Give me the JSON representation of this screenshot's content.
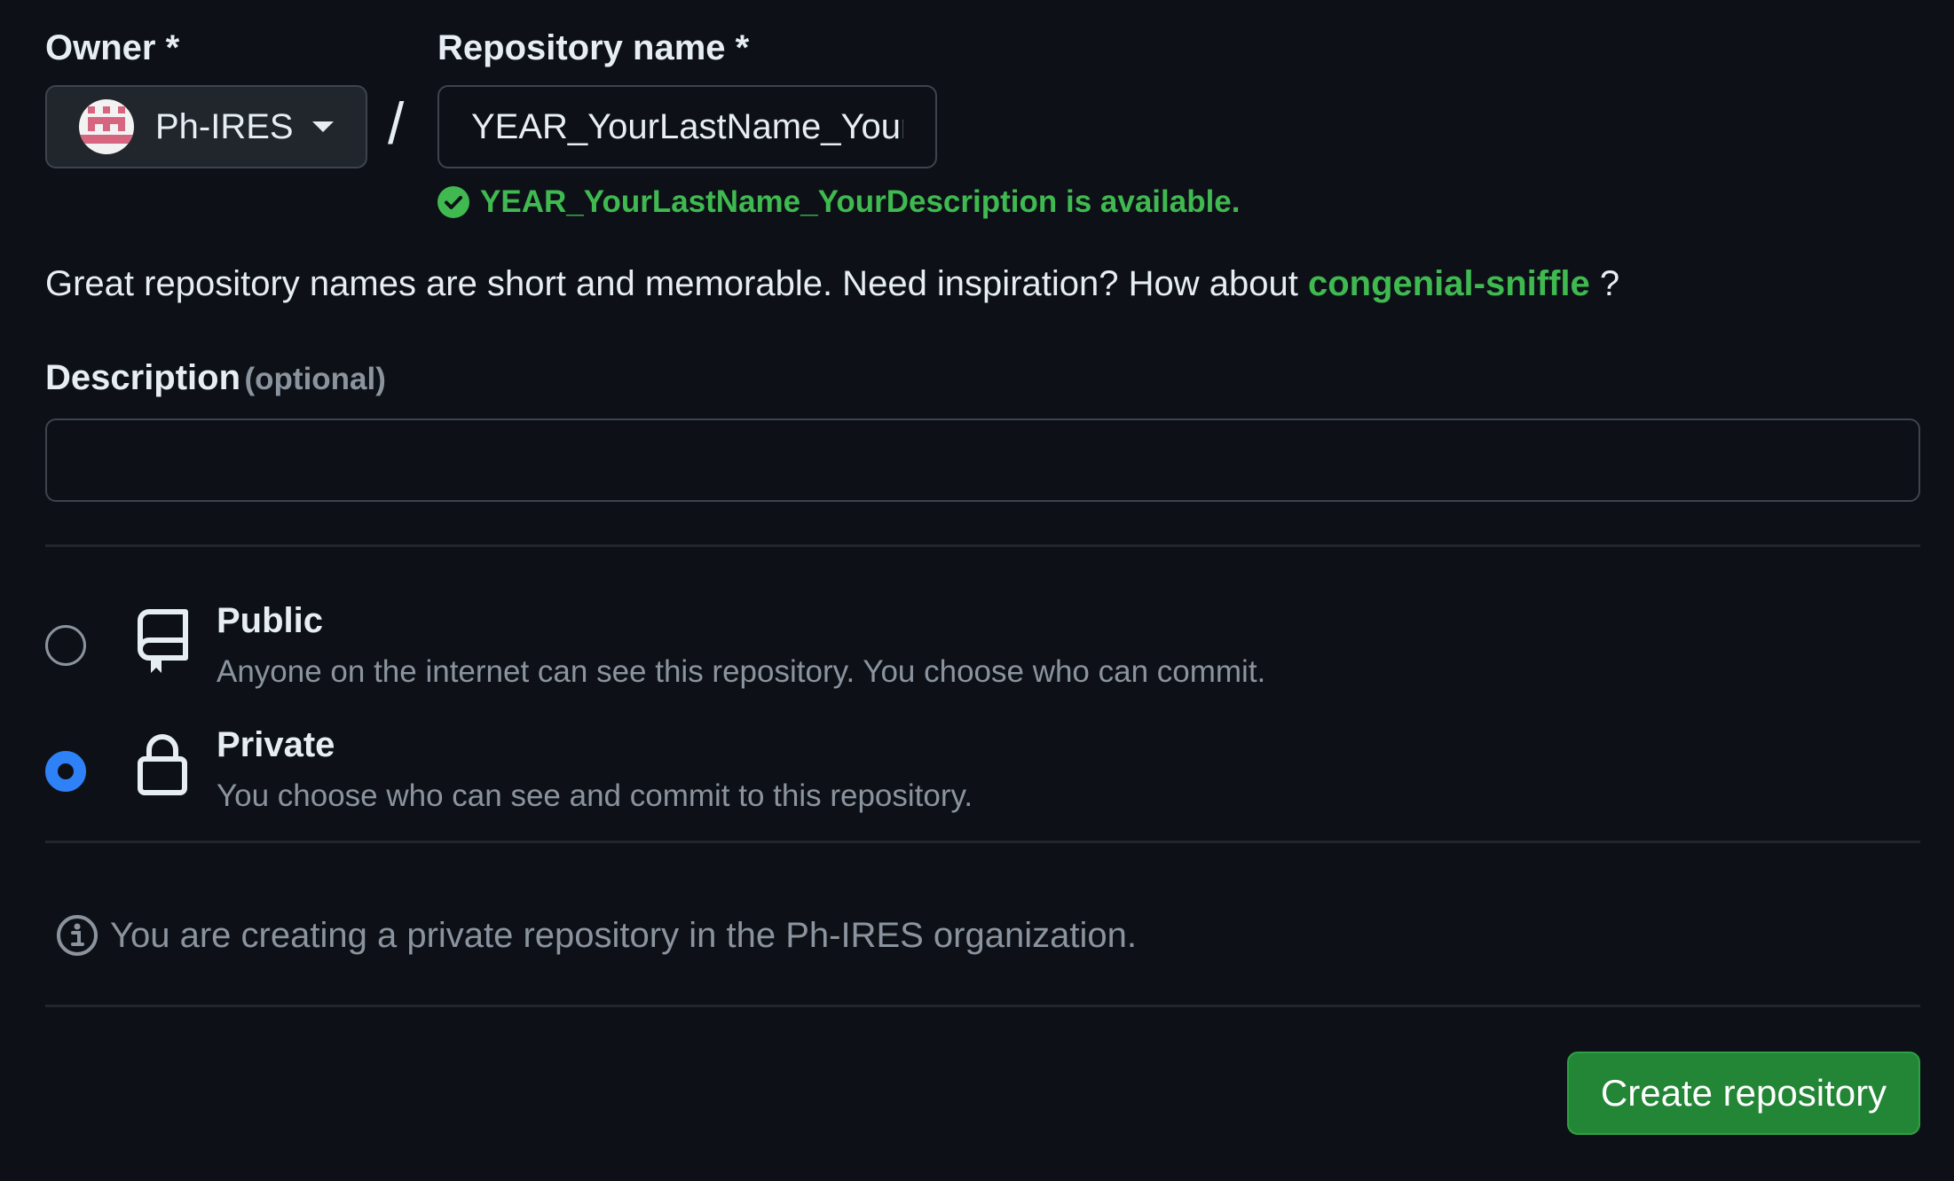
{
  "owner": {
    "label": "Owner *",
    "selected": "Ph-IRES"
  },
  "separator": "/",
  "repository_name": {
    "label": "Repository name *",
    "value": "YEAR_YourLastName_YourDescription",
    "availability": "YEAR_YourLastName_YourDescription is available."
  },
  "hint": {
    "text": "Great repository names are short and memorable. Need inspiration? How about ",
    "suggestion": "congenial-sniffle",
    "suffix": " ?"
  },
  "description": {
    "label": "Description",
    "optional": "(optional)",
    "value": ""
  },
  "visibility": {
    "selected": "private",
    "options": [
      {
        "title": "Public",
        "description": "Anyone on the internet can see this repository. You choose who can commit.",
        "icon": "repo-icon"
      },
      {
        "title": "Private",
        "description": "You choose who can see and commit to this repository.",
        "icon": "lock-icon"
      }
    ]
  },
  "info_notice": "You are creating a private repository in the Ph-IRES organization.",
  "create_button": "Create repository",
  "colors": {
    "background": "#0d1117",
    "accent_green": "#3fb950",
    "button_green": "#238636",
    "radio_blue": "#2f81f7",
    "muted": "#8b949e"
  }
}
